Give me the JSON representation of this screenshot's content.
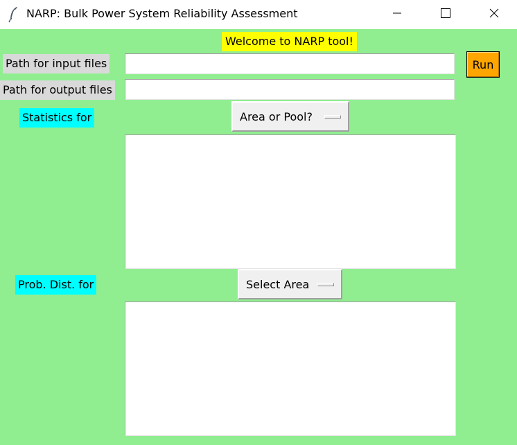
{
  "window": {
    "title": "NARP: Bulk Power System Reliability Assessment",
    "app_icon": "feather-icon",
    "controls": [
      "minimize-icon",
      "maximize-icon",
      "close-icon"
    ]
  },
  "welcome": "Welcome to NARP tool!",
  "input_path": {
    "label": "Path for input files",
    "value": ""
  },
  "output_path": {
    "label": "Path for output files",
    "value": ""
  },
  "run_button": "Run",
  "statistics": {
    "label": "Statistics for",
    "selected": "Area or Pool?",
    "text": ""
  },
  "prob_dist": {
    "label": "Prob. Dist. for",
    "selected": "Select Area",
    "text": ""
  },
  "colors": {
    "background": "#90ee90",
    "welcome_bg": "#ffff00",
    "label_gray": "#d9d9d9",
    "label_cyan": "#00ffff",
    "run_bg": "#ffa500"
  }
}
